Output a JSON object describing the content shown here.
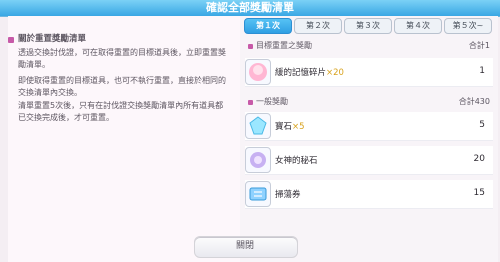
{
  "header": {
    "title": "確認全部獎勵清單"
  },
  "info": {
    "title": "關於重置獎勵清單",
    "p1": "透過交換討伐證，可在取得重置的目標道具後，立即重置獎勵清單。",
    "p2": "即使取得重置的目標道具，也可不執行重置，直接於相同的交換清單內交換。",
    "p3": "清單重置5次後，只有在討伐證交換獎勵清單內所有道具都已交換完成後，才可重置。"
  },
  "tabs": [
    {
      "label": "第１次"
    },
    {
      "label": "第２次"
    },
    {
      "label": "第３次"
    },
    {
      "label": "第４次"
    },
    {
      "label": "第５次~"
    }
  ],
  "sections": {
    "target": {
      "label": "目標重置之獎勵",
      "total": "合計1"
    },
    "general": {
      "label": "一般獎勵",
      "total": "合計430"
    }
  },
  "items": [
    {
      "name": "緩的記憶碎片",
      "mult": "×20",
      "qty": "1"
    },
    {
      "name": "寶石",
      "mult": "×5",
      "qty": "5"
    },
    {
      "name": "女神的秘石",
      "mult": "",
      "qty": "20"
    },
    {
      "name": "掃蕩券",
      "mult": "",
      "qty": "15"
    }
  ],
  "buttons": {
    "close": "關閉"
  },
  "colors": {
    "accent": "#2f9fe3",
    "bullet": "#c75aa8",
    "multiplier": "#d8a21d"
  }
}
